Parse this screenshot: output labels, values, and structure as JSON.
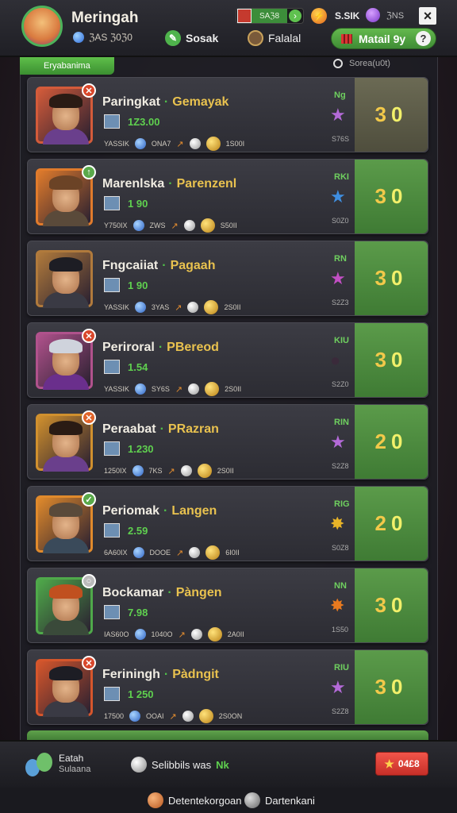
{
  "header": {
    "player_name": "Meringah",
    "player_sub": "ℨAS ℨ0ℨ0",
    "nav_social": "Sosak",
    "nav_friends": "Falalal",
    "currency_value": "SAℨ8",
    "energy_value": "S.SIK",
    "gems_value": "ℨNS",
    "match_button": "Matail 9y",
    "close": "×",
    "help": "?"
  },
  "panel": {
    "tab_label": "Eryabanima",
    "filter_label": "Sorea(u0t)"
  },
  "players": [
    {
      "name": "Paringkat",
      "title": "Gemayak",
      "score": "1Z3.00",
      "s1": "YASSIK",
      "s2": "ONA7",
      "s3": "1S00I",
      "rank": "Ng",
      "rank_sub": "S76S",
      "points_a": "3",
      "points_b": "0",
      "star": "★",
      "star_color": "#b46ad8",
      "frame": "#d35b3a",
      "hair": "#2a1b14",
      "body": "#6a3f8c",
      "badge": "✕",
      "badge_color": "#d9472b"
    },
    {
      "name": "Marenlska",
      "title": "Parenzenl",
      "score": "1 90",
      "s1": "Y750IX",
      "s2": "ZWS",
      "s3": "S50II",
      "rank": "RKI",
      "rank_sub": "S0Z0",
      "points_a": "3",
      "points_b": "0",
      "star": "★",
      "star_color": "#3f8ee0",
      "frame": "#e07b2c",
      "hair": "#6b4326",
      "body": "#5a4a3a",
      "badge": "↑",
      "badge_color": "#5aa94a"
    },
    {
      "name": "Fngcaiiat",
      "title": "Pagaah",
      "score": "1 90",
      "s1": "YASSIK",
      "s2": "3YAS",
      "s3": "2S0II",
      "rank": "RN",
      "rank_sub": "S2Z3",
      "points_a": "3",
      "points_b": "0",
      "star": "★",
      "star_color": "#c24fc4",
      "frame": "#b07a3c",
      "hair": "#1d1d24",
      "body": "#3a3a44",
      "badge": "",
      "badge_color": "transparent"
    },
    {
      "name": "Periroral",
      "title": "PBereod",
      "score": "1.54",
      "s1": "YASSIK",
      "s2": "SY6S",
      "s3": "2S0II",
      "rank": "KIU",
      "rank_sub": "S2Z0",
      "points_a": "3",
      "points_b": "0",
      "star": "●",
      "star_color": "#3a2a3a",
      "frame": "#b0528c",
      "hair": "#cfd3dc",
      "body": "#6a2f8c",
      "badge": "✕",
      "badge_color": "#d9472b"
    },
    {
      "name": "Peraabat",
      "title": "PRazran",
      "score": "1.230",
      "s1": "1250IX",
      "s2": "7KS",
      "s3": "2S0II",
      "rank": "RIN",
      "rank_sub": "S2Z8",
      "points_a": "2",
      "points_b": "0",
      "star": "★",
      "star_color": "#b46ad8",
      "frame": "#d0902e",
      "hair": "#2a1b14",
      "body": "#6a3f8c",
      "badge": "✕",
      "badge_color": "#e0642a"
    },
    {
      "name": "Periomak",
      "title": "Langen",
      "score": "2.59",
      "s1": "6A60IX",
      "s2": "DOOE",
      "s3": "6I0II",
      "rank": "RIG",
      "rank_sub": "S0Z8",
      "points_a": "2",
      "points_b": "0",
      "star": "✸",
      "star_color": "#e8b428",
      "frame": "#e08a2c",
      "hair": "#5a4a3a",
      "body": "#3a4a5a",
      "badge": "✓",
      "badge_color": "#5aa94a"
    },
    {
      "name": "Bockamar",
      "title": "Pàngen",
      "score": "7.98",
      "s1": "IAS60O",
      "s2": "1040O",
      "s3": "2A0II",
      "rank": "NN",
      "rank_sub": "1S50",
      "points_a": "3",
      "points_b": "0",
      "star": "✸",
      "star_color": "#e87a1f",
      "frame": "#4fa94a",
      "hair": "#c0501f",
      "body": "#3a4a3a",
      "badge": "○",
      "badge_color": "#bbbbbb"
    },
    {
      "name": "Feriningh",
      "title": "Pàdngit",
      "score": "1 250",
      "s1": "17500",
      "s2": "OOAI",
      "s3": "2S0ON",
      "rank": "RIU",
      "rank_sub": "S2Z8",
      "points_a": "3",
      "points_b": "0",
      "star": "★",
      "star_color": "#b46ad8",
      "frame": "#d5562c",
      "hair": "#1d1d24",
      "body": "#3a3a44",
      "badge": "✕",
      "badge_color": "#d9472b"
    }
  ],
  "bottom": {
    "team_name": "Eatah",
    "team_sub": "Sulaana",
    "status_text": "Selibbils was",
    "status_ok": "Nk",
    "buy_label": "04£8"
  },
  "footer": {
    "left": "Detentekorgoan",
    "right": "Dartenkani"
  }
}
